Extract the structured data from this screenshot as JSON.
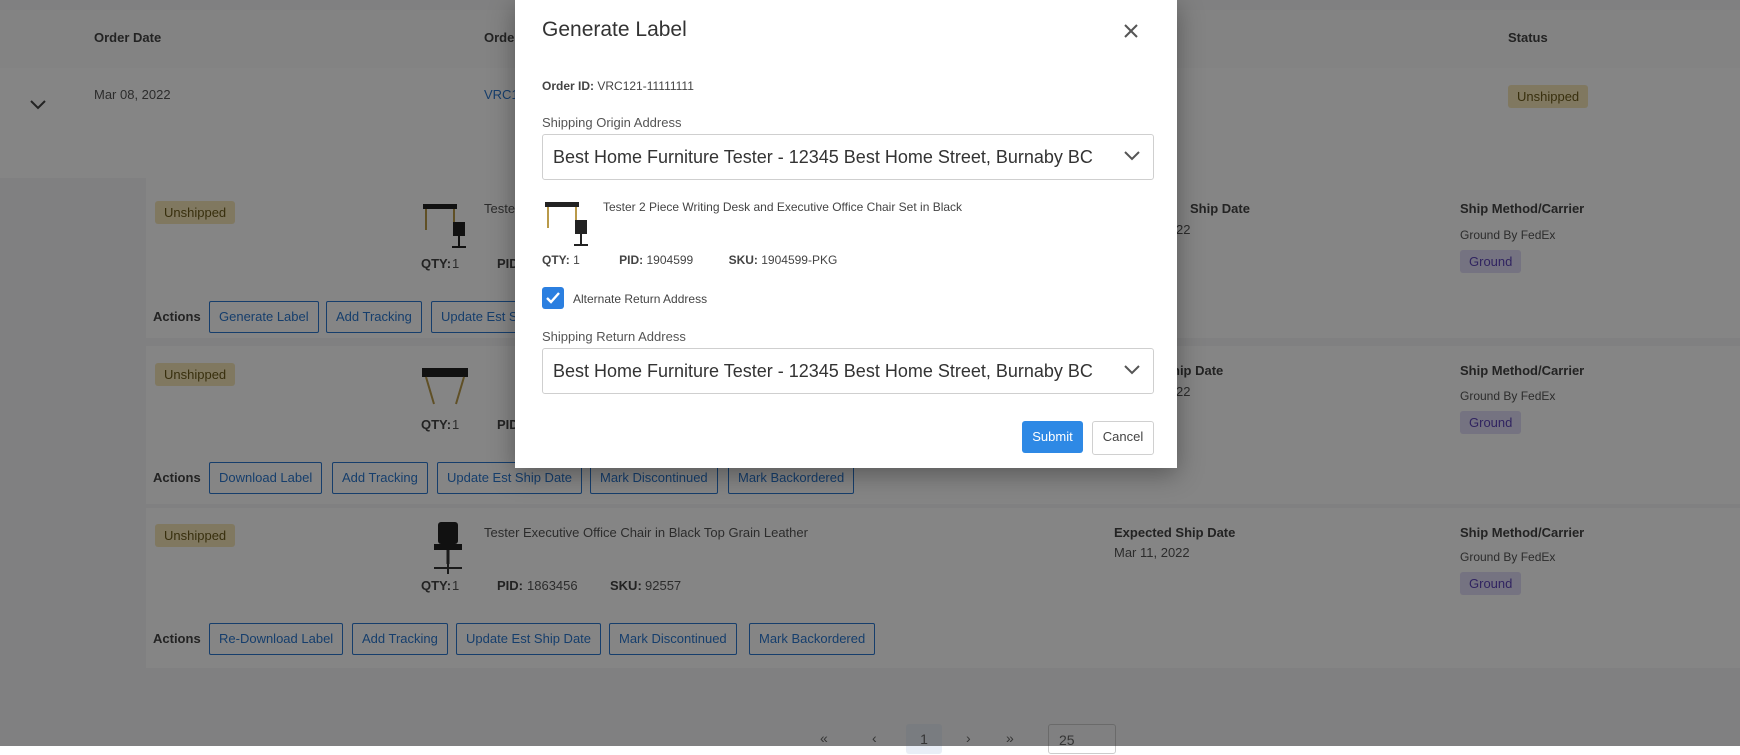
{
  "table": {
    "headers": {
      "order_date": "Order Date",
      "order_id": "Orde",
      "status": "Status"
    },
    "order": {
      "date": "Mar 08, 2022",
      "id": "VRC1",
      "status": "Unshipped"
    },
    "items": [
      {
        "status": "Unshipped",
        "name": "Tester",
        "qty_label": "QTY:",
        "qty": "1",
        "pid_label": "PID",
        "pid": "",
        "sku_label": "",
        "sku": "",
        "ship_date_label": "Ship Date",
        "ship_date": "22",
        "ship_method_label": "Ship Method/Carrier",
        "carrier": "Ground By FedEx",
        "method_badge": "Ground",
        "actions_label": "Actions",
        "actions": [
          "Generate Label",
          "Add Tracking",
          "Update Est S"
        ]
      },
      {
        "status": "Unshipped",
        "name": "",
        "qty_label": "QTY:",
        "qty": "1",
        "pid_label": "PID",
        "pid": "",
        "sku_label": "",
        "sku": "",
        "ship_date_label": "hip Date",
        "ship_date": "22",
        "ship_method_label": "Ship Method/Carrier",
        "carrier": "Ground By FedEx",
        "method_badge": "Ground",
        "actions_label": "Actions",
        "actions": [
          "Download Label",
          "Add Tracking",
          "Update Est Ship Date",
          "Mark Discontinued",
          "Mark Backordered"
        ]
      },
      {
        "status": "Unshipped",
        "name": "Tester Executive Office Chair in Black Top Grain Leather",
        "qty_label": "QTY:",
        "qty": "1",
        "pid_label": "PID:",
        "pid": "1863456",
        "sku_label": "SKU:",
        "sku": "92557",
        "ship_date_label": "Expected Ship Date",
        "ship_date": "Mar 11, 2022",
        "ship_method_label": "Ship Method/Carrier",
        "carrier": "Ground By FedEx",
        "method_badge": "Ground",
        "actions_label": "Actions",
        "actions": [
          "Re-Download Label",
          "Add Tracking",
          "Update Est Ship Date",
          "Mark Discontinued",
          "Mark Backordered"
        ]
      }
    ]
  },
  "pagination": {
    "first": "«",
    "prev": "‹",
    "current": "1",
    "next": "›",
    "last": "»",
    "per_page": "25"
  },
  "modal": {
    "title": "Generate Label",
    "order_id_label": "Order ID:",
    "order_id": "VRC121-11111111",
    "origin_label": "Shipping Origin Address",
    "origin_value": "Best Home Furniture Tester - 12345 Best Home Street, Burnaby BC",
    "product_name": "Tester 2 Piece Writing Desk and Executive Office Chair Set in Black",
    "qty_label": "QTY:",
    "qty": "1",
    "pid_label": "PID:",
    "pid": "1904599",
    "sku_label": "SKU:",
    "sku": "1904599-PKG",
    "alt_return_label": "Alternate Return Address",
    "alt_return_checked": true,
    "return_label": "Shipping Return Address",
    "return_value": "Best Home Furniture Tester - 12345 Best Home Street, Burnaby BC",
    "submit_label": "Submit",
    "cancel_label": "Cancel"
  },
  "colors": {
    "accent": "#2e89e5",
    "unshipped_badge": "#f6e7b8",
    "ground_badge": "#e1dcf7",
    "link": "#2b78d0"
  },
  "icons": {
    "expand": "chevron-down-icon",
    "close": "close-icon",
    "select_arrow": "chevron-down-icon",
    "check": "check-icon"
  }
}
